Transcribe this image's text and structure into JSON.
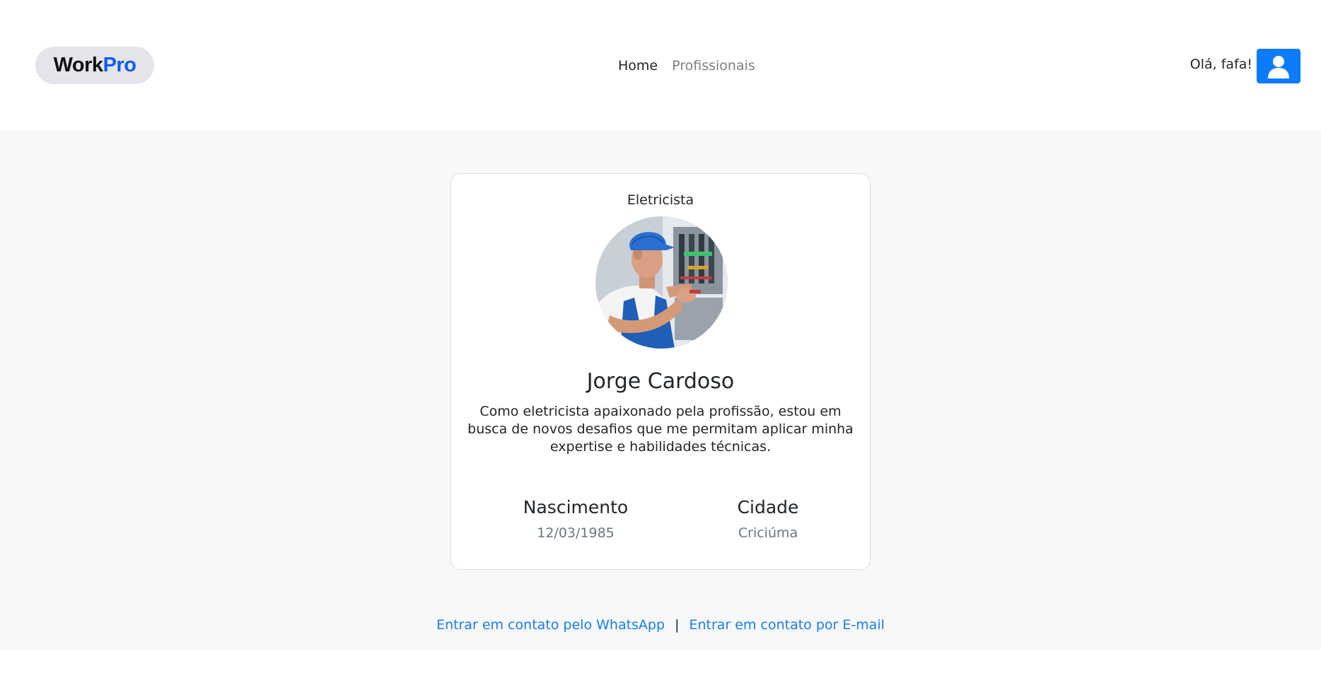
{
  "header": {
    "brand_part1": "Work",
    "brand_part2": "Pro",
    "brand_accent_color": "#0d5cf0",
    "nav": [
      {
        "label": "Home",
        "active": true
      },
      {
        "label": "Profissionais",
        "active": false
      }
    ],
    "greeting": "Olá, fafa!",
    "user_button_icon": "user-icon",
    "user_button_color": "#0d7bff"
  },
  "profile": {
    "profession": "Eletricista",
    "photo": "electrician-photo",
    "name": "Jorge Cardoso",
    "bio": "Como eletricista apaixonado pela profissão, estou em busca de novos desafios que me permitam aplicar minha expertise e habilidades técnicas.",
    "birth_label": "Nascimento",
    "birth_value": "12/03/1985",
    "city_label": "Cidade",
    "city_value": "Criciúma"
  },
  "contact": {
    "whatsapp_label": "Entrar em contato pelo WhatsApp",
    "separator": "|",
    "email_label": "Entrar em contato por E-mail",
    "link_color": "#1b7ced"
  }
}
